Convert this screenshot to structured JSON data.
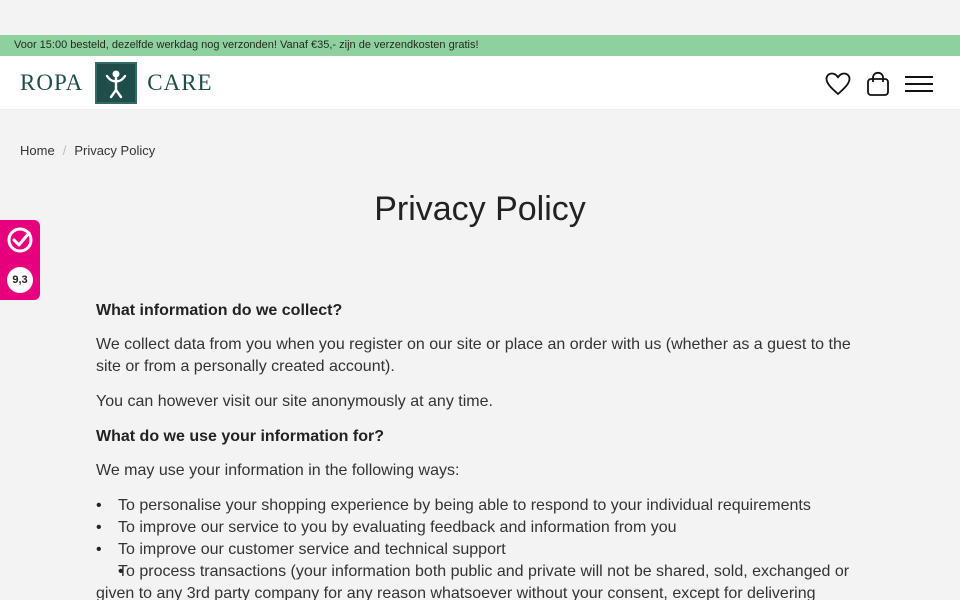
{
  "promo": {
    "text": "Voor 15:00 besteld, dezelfde werkdag nog verzonden! Vanaf €35,- zijn de verzendkosten gratis!"
  },
  "header": {
    "logo_left": "ROPA",
    "logo_right": "CARE",
    "icons": [
      "heart-icon",
      "shopping-bag-icon",
      "menu-icon"
    ]
  },
  "breadcrumb": {
    "home": "Home",
    "current": "Privacy Policy"
  },
  "page": {
    "title": "Privacy Policy"
  },
  "content": {
    "h1": "What information do we collect?",
    "p1": "We collect data from you when you register on our site or place an order with us (whether as a guest to the site or from a personally created account).",
    "p2": "You can however visit our site anonymously at any time.",
    "h2": "What do we use your information for?",
    "p3": "We may use your information in the following ways:",
    "list": [
      "To personalise your shopping experience by being able to respond to your individual requirements",
      "To improve our service to you by evaluating feedback and information from you",
      "To improve our customer service and technical support",
      "To process transactions (your information both public and private will not be shared, sold, exchanged or given to any 3rd party company for any reason whatsoever without your consent, except for delivering"
    ]
  },
  "review_badge": {
    "score": "9,3",
    "color": "#e6007e"
  },
  "colors": {
    "promo_bg": "#8fd19e",
    "brand": "#1f4e4a"
  }
}
